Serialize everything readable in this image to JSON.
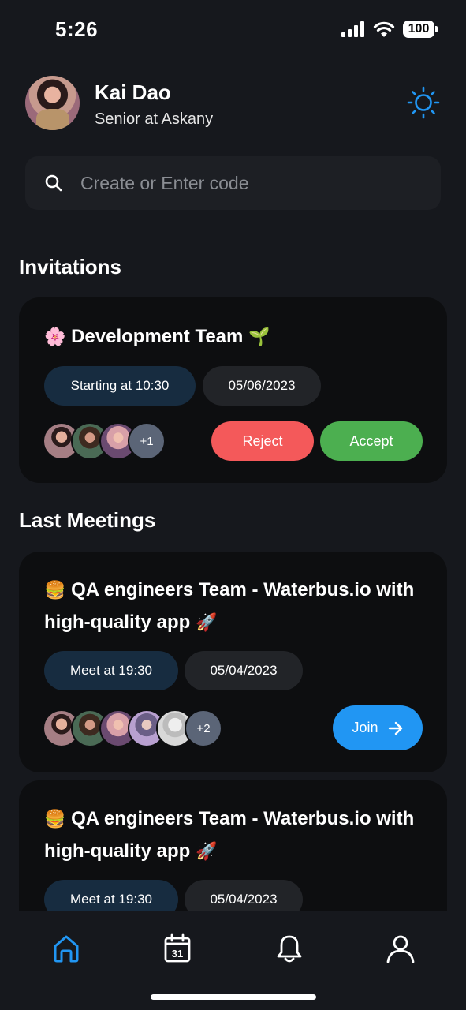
{
  "status_bar": {
    "time": "5:26",
    "battery": "100"
  },
  "profile": {
    "name": "Kai Dao",
    "role": "Senior at Askany"
  },
  "search": {
    "placeholder": "Create or Enter code"
  },
  "invitations": {
    "title": "Invitations",
    "card": {
      "emoji_left": "🌸",
      "title": "Development Team",
      "emoji_right": "🌱",
      "time_pill": "Starting at 10:30",
      "date_pill": "05/06/2023",
      "extra_participants": "+1",
      "reject_label": "Reject",
      "accept_label": "Accept"
    }
  },
  "last_meetings": {
    "title": "Last Meetings",
    "items": [
      {
        "emoji_left": "🍔",
        "title": "QA engineers Team - Waterbus.io with high-quality app",
        "emoji_right": "🚀",
        "time_pill": "Meet at 19:30",
        "date_pill": "05/04/2023",
        "extra_participants": "+2",
        "join_label": "Join"
      },
      {
        "emoji_left": "🍔",
        "title": "QA engineers Team - Waterbus.io with high-quality app",
        "emoji_right": "🚀",
        "time_pill": "Meet at 19:30",
        "date_pill": "05/04/2023"
      }
    ]
  },
  "bottom_nav": {
    "items": [
      "home-icon",
      "calendar-icon",
      "bell-icon",
      "profile-icon"
    ],
    "calendar_day": "31",
    "active_color": "#2196f3"
  },
  "colors": {
    "background": "#16181d",
    "card": "#0d0e10",
    "accent": "#2196f3",
    "reject": "#f4595a",
    "accept": "#4caf50"
  }
}
